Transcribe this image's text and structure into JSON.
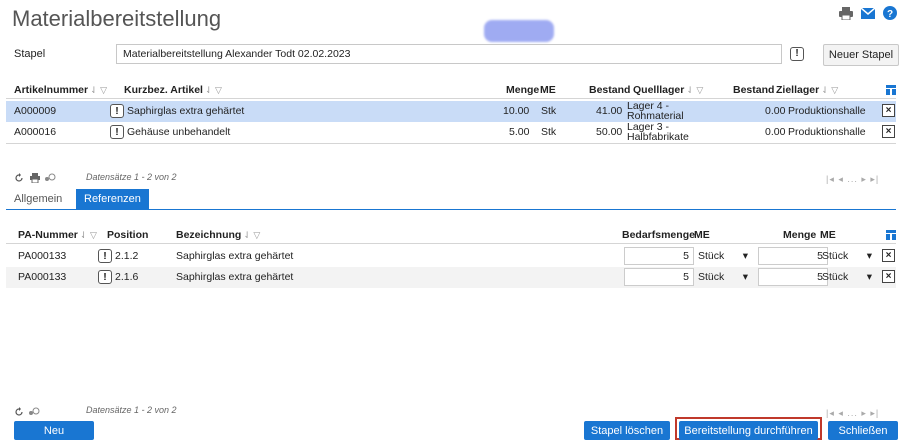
{
  "title": "Materialbereitstellung",
  "stapel": {
    "label": "Stapel",
    "value": "Materialbereitstellung Alexander Todt 02.02.2023",
    "new_button": "Neuer Stapel"
  },
  "articles_table": {
    "headers": {
      "artikelnummer": "Artikelnummer",
      "kurzbez": "Kurzbez. Artikel",
      "menge": "Menge",
      "me": "ME",
      "bestand": "Bestand",
      "quelllager": "Quelllager",
      "bestand2": "Bestand",
      "ziellager": "Ziellager"
    },
    "rows": [
      {
        "artikelnummer": "A000009",
        "kurzbez": "Saphirglas extra gehärtet",
        "menge": "10.00",
        "me": "Stk",
        "bestand": "41.00",
        "quelllager_1": "Lager 4 -",
        "quelllager_2": "Rohmaterial",
        "bestand2": "0.00",
        "ziellager": "Produktionshalle"
      },
      {
        "artikelnummer": "A000016",
        "kurzbez": "Gehäuse unbehandelt",
        "menge": "5.00",
        "me": "Stk",
        "bestand": "50.00",
        "quelllager_1": "Lager 3 -",
        "quelllager_2": "Halbfabrikate",
        "bestand2": "0.00",
        "ziellager": "Produktionshalle"
      }
    ],
    "pager": "Datensätze 1 - 2 von 2"
  },
  "tabs": [
    "Allgemein",
    "Referenzen"
  ],
  "ref_table": {
    "headers": {
      "pa_nummer": "PA-Nummer",
      "position": "Position",
      "bezeichnung": "Bezeichnung",
      "bedarfsmenge": "Bedarfsmenge",
      "me": "ME",
      "menge": "Menge",
      "me2": "ME"
    },
    "rows": [
      {
        "pa_nummer": "PA000133",
        "position": "2.1.2",
        "bezeichnung": "Saphirglas extra gehärtet",
        "bedarfsmenge": "5",
        "me": "Stück",
        "menge": "5",
        "me2": "Stück"
      },
      {
        "pa_nummer": "PA000133",
        "position": "2.1.6",
        "bezeichnung": "Saphirglas extra gehärtet",
        "bedarfsmenge": "5",
        "me": "Stück",
        "menge": "5",
        "me2": "Stück"
      }
    ],
    "pager": "Datensätze 1 - 2 von 2"
  },
  "footer": {
    "neu": "Neu",
    "stapel_loeschen": "Stapel löschen",
    "durchfuehren": "Bereitstellung durchführen",
    "schliessen": "Schließen"
  },
  "glyphs": {
    "excl": "!",
    "x": "×",
    "chevron": "▾",
    "sort": "⇃ ▽",
    "pagenav": "|◂ ◂ ... ▸ ▸|"
  },
  "colors": {
    "accent": "#1976d2",
    "selected_row": "#c9dcf7",
    "highlight_border": "#c0392b"
  }
}
